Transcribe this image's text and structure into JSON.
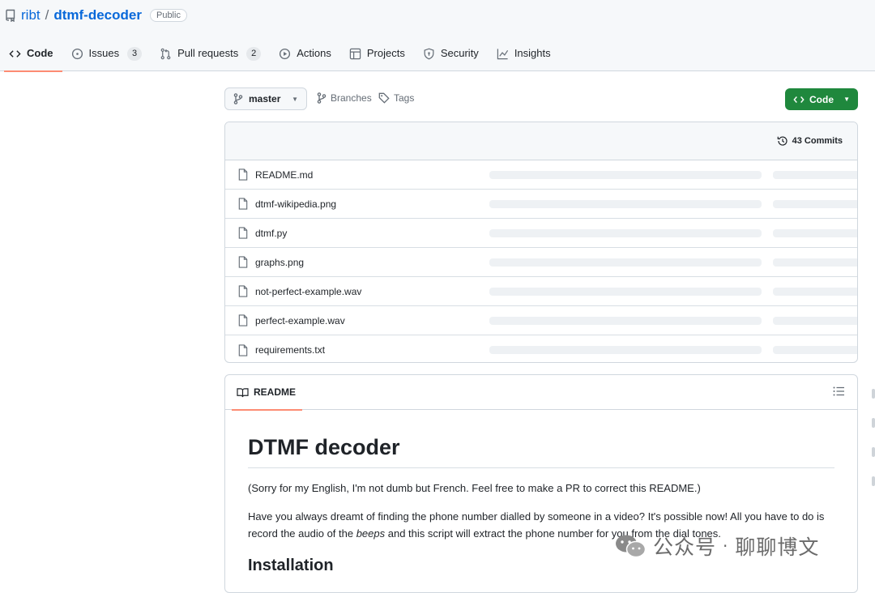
{
  "repo": {
    "owner": "ribt",
    "separator": "/",
    "name": "dtmf-decoder",
    "visibility": "Public"
  },
  "nav": [
    {
      "label": "Code",
      "icon": "code-icon",
      "active": true
    },
    {
      "label": "Issues",
      "icon": "issue-icon",
      "count": "3"
    },
    {
      "label": "Pull requests",
      "icon": "pull-request-icon",
      "count": "2"
    },
    {
      "label": "Actions",
      "icon": "play-icon"
    },
    {
      "label": "Projects",
      "icon": "table-icon"
    },
    {
      "label": "Security",
      "icon": "shield-icon"
    },
    {
      "label": "Insights",
      "icon": "graph-icon"
    }
  ],
  "toolbar": {
    "branch": "master",
    "branches": "Branches",
    "tags": "Tags",
    "code_button": "Code"
  },
  "files": {
    "commits": "43 Commits",
    "items": [
      "README.md",
      "dtmf-wikipedia.png",
      "dtmf.py",
      "graphs.png",
      "not-perfect-example.wav",
      "perfect-example.wav",
      "requirements.txt"
    ]
  },
  "readme": {
    "tab": "README",
    "title": "DTMF decoder",
    "p1": "(Sorry for my English, I'm not dumb but French. Feel free to make a PR to correct this README.)",
    "p2_before": "Have you always dreamt of finding the phone number dialled by someone in a video? It's possible now! All you have to do is record the audio of the ",
    "p2_em": "beeps",
    "p2_after": " and this script will extract the phone number for you from the dial tones.",
    "h2": "Installation"
  },
  "watermark": {
    "text1": "公众号",
    "dot": "·",
    "text2": "聊聊博文"
  },
  "colors": {
    "accent": "#fd8c73",
    "link": "#0969da",
    "primary_button": "#1f883d"
  }
}
